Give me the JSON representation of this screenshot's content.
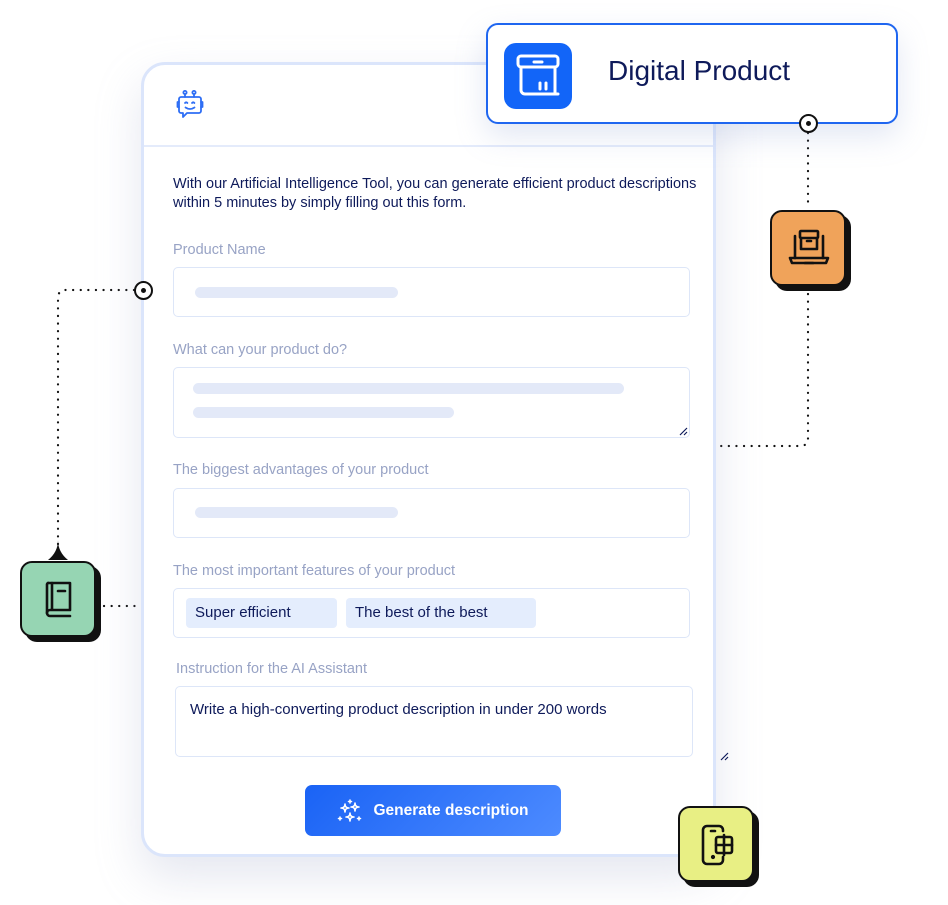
{
  "product_badge": {
    "title": "Digital Product",
    "icon": "archive-box-icon",
    "accent": "#1265f8"
  },
  "form": {
    "header_icon": "robot-chat-icon",
    "intro": "With our Artificial Intelligence Tool, you can generate efficient product descriptions within 5 minutes by simply filling out this form.",
    "fields": [
      {
        "label": "Product Name",
        "value": ""
      },
      {
        "label": "What can your product do?",
        "value": ""
      },
      {
        "label": "The biggest advantages of your product",
        "value": ""
      },
      {
        "label": "The most important features of your product",
        "tags": [
          "Super efficient",
          "The best of the best"
        ]
      },
      {
        "label": "Instruction for the AI Assistant",
        "value": "Write a high-converting product description in under 200 words"
      }
    ],
    "submit_label": "Generate description",
    "submit_icon": "sparkles-icon"
  },
  "floating_tiles": [
    {
      "icon": "laptop-box-icon",
      "color": "#f0a35a"
    },
    {
      "icon": "book-icon",
      "color": "#96d5b3"
    },
    {
      "icon": "devices-icon",
      "color": "#e8ef84"
    }
  ]
}
